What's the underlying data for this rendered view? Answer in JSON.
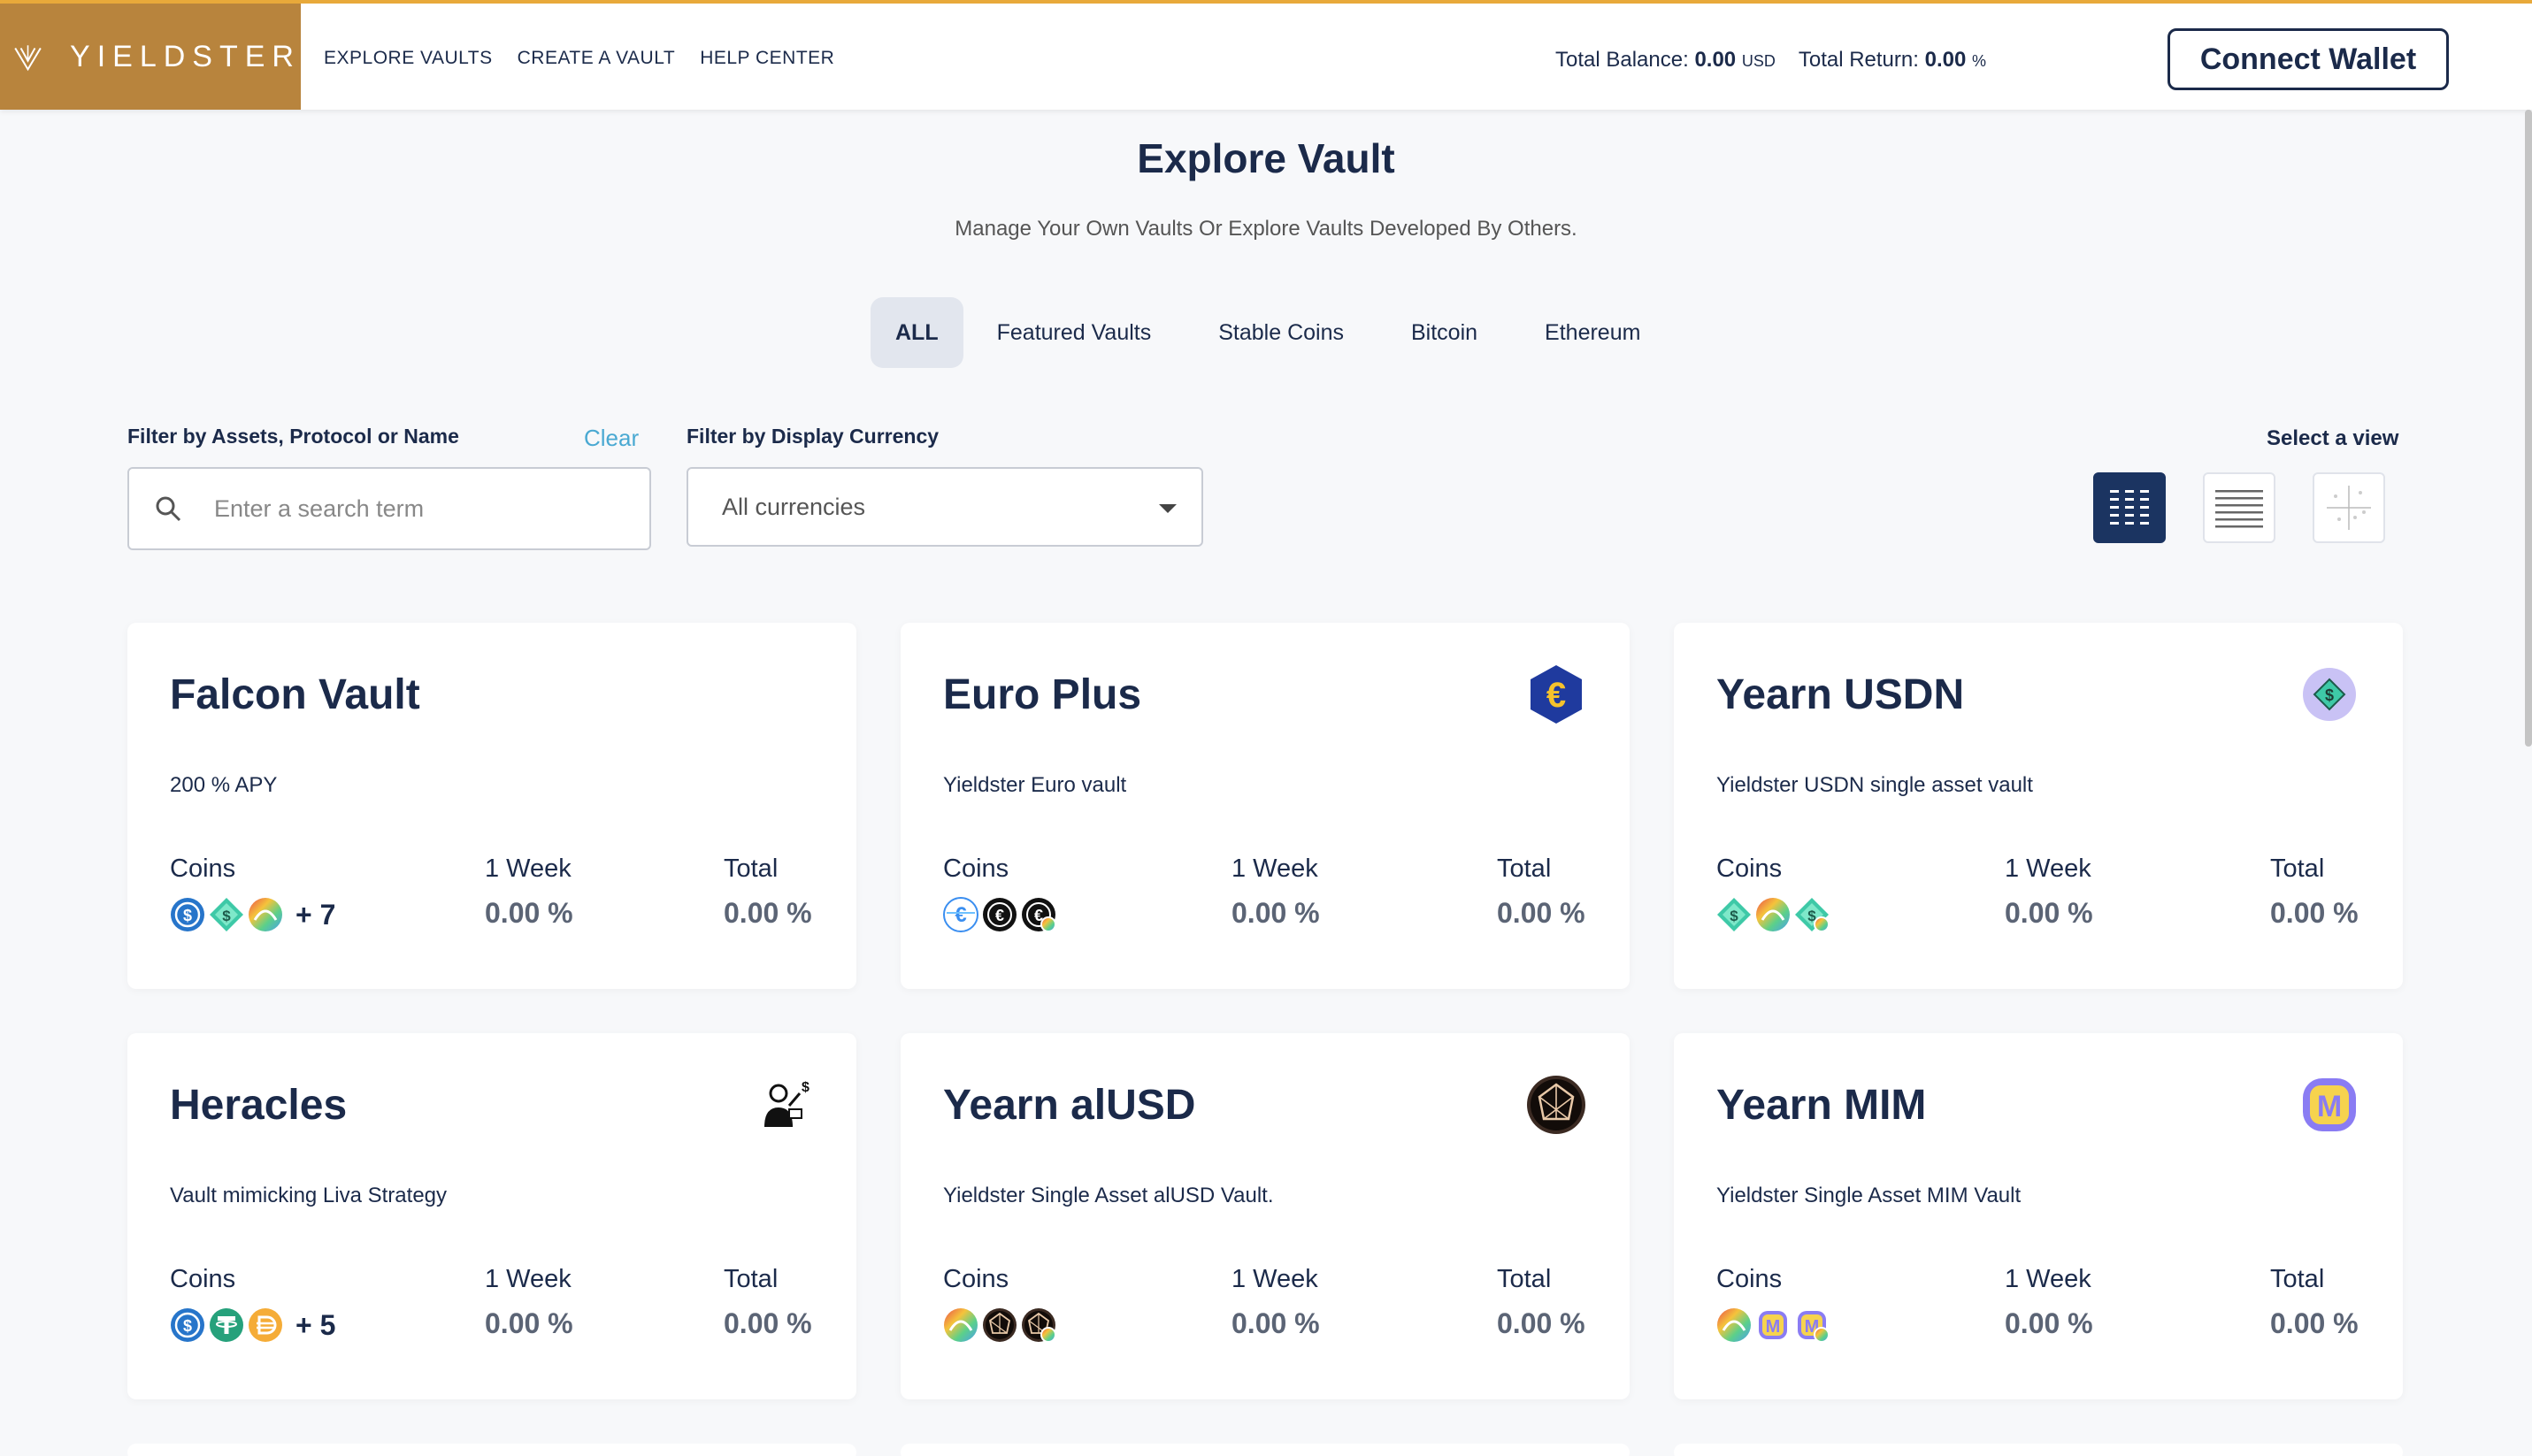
{
  "header": {
    "brand": "YIELDSTER",
    "nav": [
      "EXPLORE VAULTS",
      "CREATE A VAULT",
      "HELP CENTER"
    ],
    "total_balance_label": "Total Balance:",
    "total_balance_value": "0.00",
    "total_balance_unit": "USD",
    "total_return_label": "Total Return:",
    "total_return_value": "0.00",
    "total_return_unit": "%",
    "connect_label": "Connect Wallet"
  },
  "page": {
    "title": "Explore Vault",
    "subtitle": "Manage Your Own Vaults Or Explore Vaults Developed By Others."
  },
  "tabs": [
    "ALL",
    "Featured Vaults",
    "Stable Coins",
    "Bitcoin",
    "Ethereum"
  ],
  "filters": {
    "search_label": "Filter by Assets, Protocol or Name",
    "clear_label": "Clear",
    "search_placeholder": "Enter a search term",
    "currency_label": "Filter by Display Currency",
    "currency_value": "All currencies",
    "view_label": "Select a view"
  },
  "colors": {
    "brand": "#b8843d",
    "accent_top": "#e8a93a",
    "navy": "#1b2a4a",
    "link": "#4aa9d2"
  },
  "labels": {
    "coins": "Coins",
    "week": "1 Week",
    "total": "Total"
  },
  "cards": [
    {
      "name": "Falcon Vault",
      "desc": "200 % APY",
      "week": "0.00 %",
      "total": "0.00 %",
      "more": "+ 7",
      "icon": "none",
      "coins": [
        "usdc-icon",
        "usdn-icon",
        "rainbow-icon"
      ]
    },
    {
      "name": "Euro Plus",
      "desc": "Yieldster Euro vault",
      "week": "0.00 %",
      "total": "0.00 %",
      "more": "",
      "icon": "euro-hex-icon",
      "coins": [
        "euro-stripe-icon",
        "euro-dark-icon",
        "euro-dark-badge-icon"
      ]
    },
    {
      "name": "Yearn USDN",
      "desc": "Yieldster USDN single asset vault",
      "week": "0.00 %",
      "total": "0.00 %",
      "more": "",
      "icon": "usdn-purple-icon",
      "coins": [
        "usdn-icon",
        "rainbow-icon",
        "usdn-badge-icon"
      ]
    },
    {
      "name": "Heracles",
      "desc": "Vault mimicking Liva Strategy",
      "week": "0.00 %",
      "total": "0.00 %",
      "more": "+ 5",
      "icon": "person-money-icon",
      "coins": [
        "usdc-icon",
        "tether-icon",
        "dai-icon"
      ]
    },
    {
      "name": "Yearn alUSD",
      "desc": "Yieldster Single Asset alUSD Vault.",
      "week": "0.00 %",
      "total": "0.00 %",
      "more": "",
      "icon": "alusd-icon",
      "coins": [
        "rainbow-icon",
        "alusd-icon",
        "alusd-badge-icon"
      ]
    },
    {
      "name": "Yearn MIM",
      "desc": "Yieldster Single Asset MIM Vault",
      "week": "0.00 %",
      "total": "0.00 %",
      "more": "",
      "icon": "mim-icon",
      "coins": [
        "rainbow-icon",
        "mim-icon",
        "mim-badge-icon"
      ]
    }
  ]
}
